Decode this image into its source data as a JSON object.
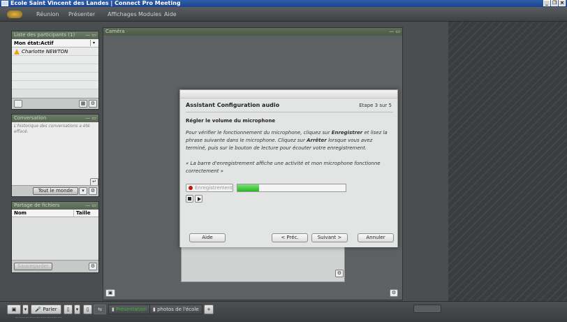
{
  "window": {
    "title": "Ecole Saint Vincent des Landes | Connect Pro Meeting",
    "controls": [
      "_",
      "❐",
      "×"
    ]
  },
  "menu": [
    "Réunion",
    "Présenter",
    "Affichages",
    "Modules",
    "Aide"
  ],
  "attendees_pod": {
    "title": "Liste des participants (1)",
    "status": "Mon état:Actif",
    "attendees": [
      "Charlotte NEWTON"
    ]
  },
  "chat_pod": {
    "title": "Conversation",
    "message": "L'historique des conversations a été effacé.",
    "recipient": "Tout le monde"
  },
  "files_pod": {
    "title": "Partage de fichiers",
    "col_name": "Nom",
    "col_size": "Taille",
    "save_label": "Sauvegarder"
  },
  "camera_pod": {
    "title": "Caméra"
  },
  "dialog": {
    "title": "Assistant Configuration audio",
    "step": "Etape 3 sur 5",
    "subtitle": "Régler le volume du microphone",
    "desc_1": "Pour vérifier le fonctionnement du microphone, cliquez sur ",
    "desc_bold_1": "Enregistrer",
    "desc_2": " et lisez la phrase suivante dans le microphone. Cliquez sur ",
    "desc_bold_2": "Arrêter",
    "desc_3": " lorsque vous avez terminé, puis sur le bouton de lecture pour écouter votre enregistrement.",
    "phrase": "« La barre d'enregistrement affiche une activité et mon microphone fonctionne correctement »",
    "record_label": "Enregistrement",
    "level": 0.2,
    "help_label": "Aide",
    "prev_label": "< Préc.",
    "next_label": "Suivant >",
    "cancel_label": "Annuler"
  },
  "bottombar": {
    "talk_label": "Parler",
    "tabs": [
      "Présentation",
      "photos de l'école"
    ],
    "add_label": "+"
  },
  "colors": {
    "accent_green": "#23b722",
    "record_red": "#c41515",
    "titlebar_blue": "#1b4590"
  }
}
